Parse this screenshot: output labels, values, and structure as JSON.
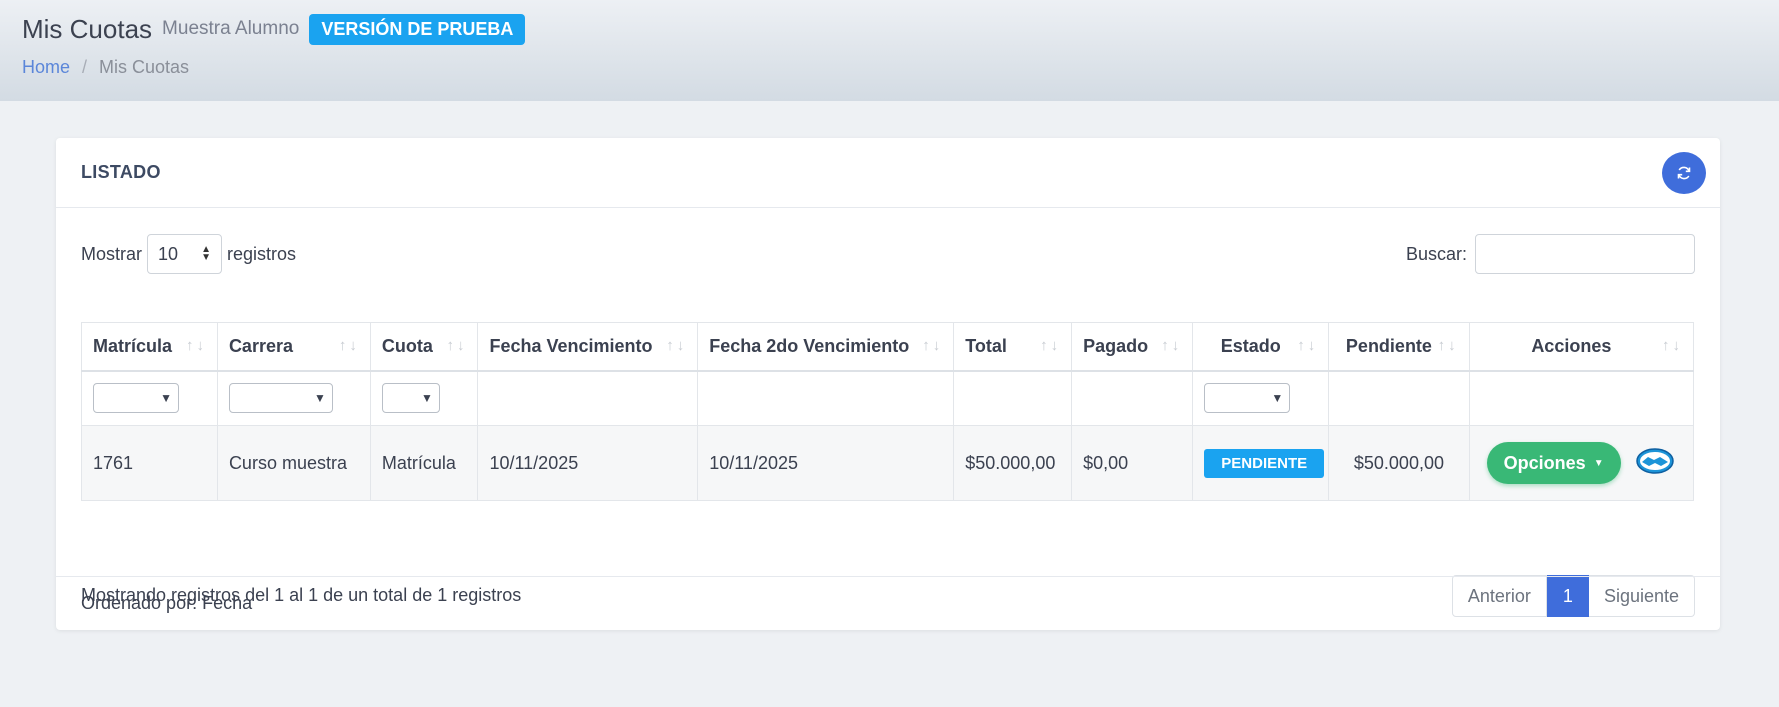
{
  "header": {
    "title": "Mis Cuotas",
    "subtitle": "Muestra Alumno",
    "badge": "VERSIÓN DE PRUEBA",
    "breadcrumb": {
      "home": "Home",
      "separator": "/",
      "current": "Mis Cuotas"
    }
  },
  "card": {
    "title": "LISTADO",
    "refresh_icon": "refresh-icon",
    "length": {
      "prefix": "Mostrar",
      "value": "10",
      "suffix": "registros"
    },
    "search": {
      "label": "Buscar:",
      "value": ""
    },
    "table": {
      "columns": [
        "Matrícula",
        "Carrera",
        "Cuota",
        "Fecha Vencimiento",
        "Fecha 2do Vencimiento",
        "Total",
        "Pagado",
        "Estado",
        "Pendiente",
        "Acciones"
      ],
      "rows": [
        {
          "matricula": "1761",
          "carrera": "Curso muestra",
          "cuota": "Matrícula",
          "fecha_venc": "10/11/2025",
          "fecha_2do_venc": "10/11/2025",
          "total": "$50.000,00",
          "pagado": "$0,00",
          "estado": "PENDIENTE",
          "pendiente": "$50.000,00",
          "accion": "Opciones"
        }
      ]
    },
    "info": "Mostrando registros del 1 al 1 de un total de 1 registros",
    "pagination": {
      "prev": "Anterior",
      "current": "1",
      "next": "Siguiente"
    },
    "footer": "Ordenado por: Fecha"
  },
  "colors": {
    "accent": "#3f6ddb",
    "badge": "#1aa3f0",
    "success": "#39b876",
    "danger": "#e3152b"
  }
}
